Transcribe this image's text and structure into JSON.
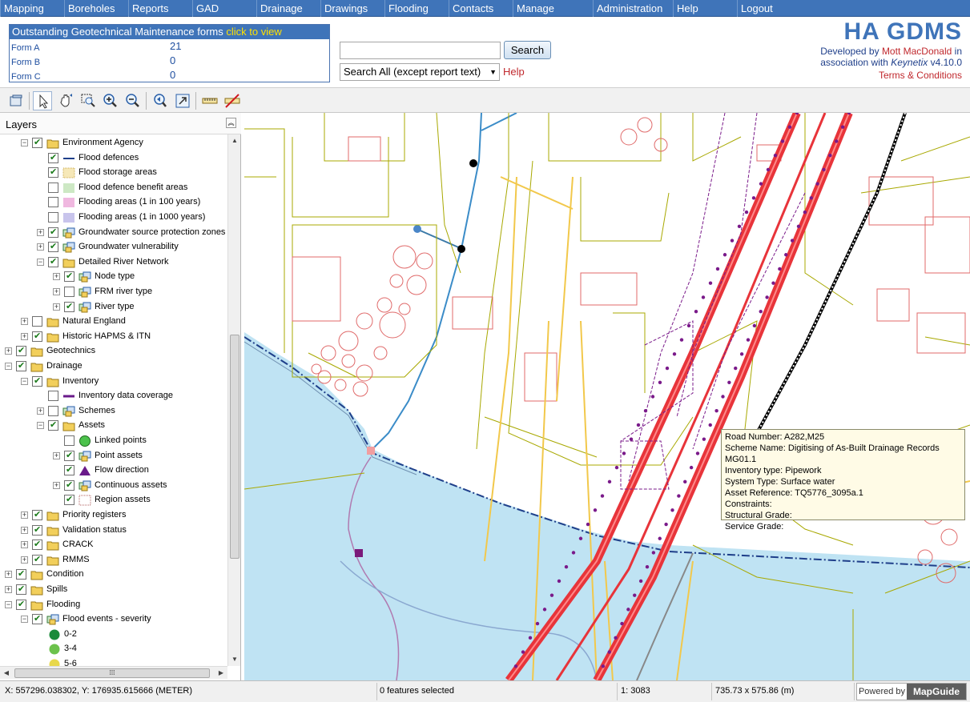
{
  "menu": [
    "Mapping",
    "Boreholes",
    "Reports",
    "GAD",
    "Drainage",
    "Drawings",
    "Flooding",
    "Contacts",
    "Manage",
    "Administration",
    "Help",
    "Logout"
  ],
  "forms": {
    "title": "Outstanding Geotechnical Maintenance forms",
    "link": "click to view",
    "rows": [
      {
        "label": "Form A",
        "value": "21"
      },
      {
        "label": "Form B",
        "value": "0"
      },
      {
        "label": "Form C",
        "value": "0"
      }
    ]
  },
  "search": {
    "value": "",
    "button": "Search",
    "scope": "Search All (except report text)",
    "help": "Help"
  },
  "brand": {
    "title": "HA GDMS",
    "developed_prefix": "Developed by",
    "company": "Mott MacDonald",
    "suffix": "in",
    "assoc": "association with",
    "partner": "Keynetix",
    "version": "v4.10.0",
    "terms": "Terms & Conditions"
  },
  "toolbar": {
    "icons": [
      "layers-icon",
      "select-pointer-icon",
      "pan-icon",
      "zoom-rectangle-icon",
      "zoom-in-icon",
      "zoom-out-icon",
      "zoom-previous-icon",
      "zoom-extents-icon",
      "measure-icon",
      "clear-measure-icon"
    ]
  },
  "layers_panel": {
    "title": "Layers",
    "items": [
      {
        "label": "Environment Agency",
        "level": 1,
        "expand": "minus",
        "checked": true,
        "icon": "folder"
      },
      {
        "label": "Flood defences",
        "level": 2,
        "expand": "",
        "checked": true,
        "icon": "line"
      },
      {
        "label": "Flood storage areas",
        "level": 2,
        "expand": "",
        "checked": true,
        "icon": "dotted"
      },
      {
        "label": "Flood defence benefit areas",
        "level": 2,
        "expand": "",
        "checked": false,
        "icon": "green-area"
      },
      {
        "label": "Flooding areas (1 in 100 years)",
        "level": 2,
        "expand": "",
        "checked": false,
        "icon": "pink-area"
      },
      {
        "label": "Flooding areas (1 in 1000 years)",
        "level": 2,
        "expand": "",
        "checked": false,
        "icon": "lilac-area"
      },
      {
        "label": "Groundwater source protection zones",
        "level": 2,
        "expand": "plus",
        "checked": true,
        "icon": "layers"
      },
      {
        "label": "Groundwater vulnerability",
        "level": 2,
        "expand": "plus",
        "checked": true,
        "icon": "layers"
      },
      {
        "label": "Detailed River Network",
        "level": 2,
        "expand": "minus",
        "checked": true,
        "icon": "folder"
      },
      {
        "label": "Node type",
        "level": 3,
        "expand": "plus",
        "checked": true,
        "icon": "layers"
      },
      {
        "label": "FRM river type",
        "level": 3,
        "expand": "plus",
        "checked": false,
        "icon": "layers"
      },
      {
        "label": "River type",
        "level": 3,
        "expand": "plus",
        "checked": true,
        "icon": "layers"
      },
      {
        "label": "Natural England",
        "level": 1,
        "expand": "plus",
        "checked": false,
        "icon": "folder"
      },
      {
        "label": "Historic HAPMS & ITN",
        "level": 1,
        "expand": "plus",
        "checked": true,
        "icon": "folder"
      },
      {
        "label": "Geotechnics",
        "level": 0,
        "expand": "plus",
        "checked": true,
        "icon": "folder"
      },
      {
        "label": "Drainage",
        "level": 0,
        "expand": "minus",
        "checked": true,
        "icon": "folder"
      },
      {
        "label": "Inventory",
        "level": 1,
        "expand": "minus",
        "checked": true,
        "icon": "folder"
      },
      {
        "label": "Inventory data coverage",
        "level": 2,
        "expand": "",
        "checked": false,
        "icon": "purple-line"
      },
      {
        "label": "Schemes",
        "level": 2,
        "expand": "plus",
        "checked": false,
        "icon": "layers"
      },
      {
        "label": "Assets",
        "level": 2,
        "expand": "minus",
        "checked": true,
        "icon": "folder"
      },
      {
        "label": "Linked points",
        "level": 3,
        "expand": "",
        "checked": false,
        "icon": "green-circle"
      },
      {
        "label": "Point assets",
        "level": 3,
        "expand": "plus",
        "checked": true,
        "icon": "layers"
      },
      {
        "label": "Flow direction",
        "level": 3,
        "expand": "",
        "checked": true,
        "icon": "triangle"
      },
      {
        "label": "Continuous assets",
        "level": 3,
        "expand": "plus",
        "checked": true,
        "icon": "layers"
      },
      {
        "label": "Region assets",
        "level": 3,
        "expand": "",
        "checked": true,
        "icon": "region"
      },
      {
        "label": "Priority registers",
        "level": 1,
        "expand": "plus",
        "checked": true,
        "icon": "folder"
      },
      {
        "label": "Validation status",
        "level": 1,
        "expand": "plus",
        "checked": true,
        "icon": "folder"
      },
      {
        "label": "CRACK",
        "level": 1,
        "expand": "plus",
        "checked": true,
        "icon": "folder"
      },
      {
        "label": "RMMS",
        "level": 1,
        "expand": "plus",
        "checked": true,
        "icon": "folder"
      },
      {
        "label": "Condition",
        "level": 0,
        "expand": "plus",
        "checked": true,
        "icon": "folder"
      },
      {
        "label": "Spills",
        "level": 0,
        "expand": "plus",
        "checked": true,
        "icon": "folder"
      },
      {
        "label": "Flooding",
        "level": 0,
        "expand": "minus",
        "checked": true,
        "icon": "folder"
      },
      {
        "label": "Flood events - severity",
        "level": 1,
        "expand": "minus",
        "checked": true,
        "icon": "layers"
      },
      {
        "label": "0-2",
        "level": 2,
        "expand": "",
        "checked": null,
        "icon": "dot-dkgreen"
      },
      {
        "label": "3-4",
        "level": 2,
        "expand": "",
        "checked": null,
        "icon": "dot-green"
      },
      {
        "label": "5-6",
        "level": 2,
        "expand": "",
        "checked": null,
        "icon": "dot-yellow"
      }
    ]
  },
  "tooltip": [
    {
      "label": "Road Number:",
      "value": "A282,M25"
    },
    {
      "label": "Scheme Name:",
      "value": "Digitising of As-Built Drainage Records MG01.1"
    },
    {
      "label": "Inventory type:",
      "value": "Pipework"
    },
    {
      "label": "System Type:",
      "value": "Surface water"
    },
    {
      "label": "Asset Reference:",
      "value": "TQ5776_3095a.1"
    },
    {
      "label": "Constraints:",
      "value": ""
    },
    {
      "label": "Structural Grade:",
      "value": ""
    },
    {
      "label": "Service Grade:",
      "value": ""
    }
  ],
  "status": {
    "coords": "X: 557296.038302, Y: 176935.615666 (METER)",
    "selected": "0 features selected",
    "scale": "1: 3083",
    "size": "735.73 x 575.86 (m)",
    "powered": "Powered by",
    "product": "MapGuide"
  },
  "colors": {
    "menu": "#3f74b9",
    "accent": "#c0282d",
    "water": "#bfe3f3",
    "road": "#e8343a"
  }
}
